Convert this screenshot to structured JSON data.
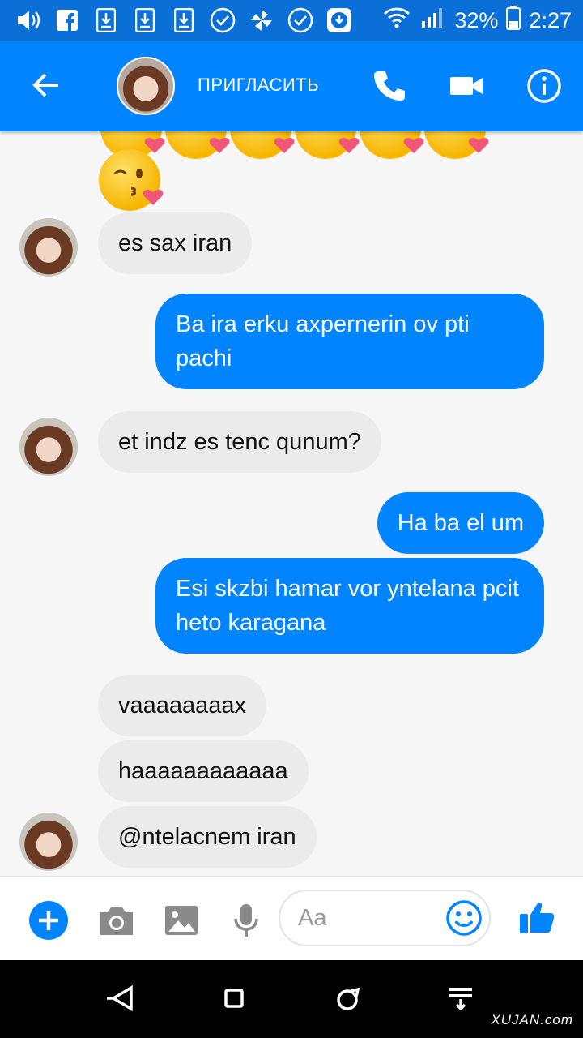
{
  "status_bar": {
    "battery": "32%",
    "time": "2:27"
  },
  "header": {
    "invite_label": "ПРИГЛАСИТЬ"
  },
  "messages": [
    {
      "from": "them",
      "text": "es sax iran"
    },
    {
      "from": "me",
      "text": "Ba ira erku axpernerin ov pti pachi"
    },
    {
      "from": "them",
      "text": "et indz es tenc qunum?"
    },
    {
      "from": "me",
      "text": "Ha ba el um"
    },
    {
      "from": "me",
      "text": "Esi skzbi hamar vor yntelana pcit heto karagana"
    },
    {
      "from": "them",
      "text": "vaaaaaaaax"
    },
    {
      "from": "them",
      "text": "haaaaaaaaaaaa"
    },
    {
      "from": "them",
      "text": "@ntelacnem iran"
    }
  ],
  "composer": {
    "placeholder": "Aa"
  },
  "watermark": "XUJAN.com",
  "colors": {
    "brand": "#0084ff",
    "statusbar": "#0a6fd6",
    "incoming_bubble": "#ebebeb"
  }
}
